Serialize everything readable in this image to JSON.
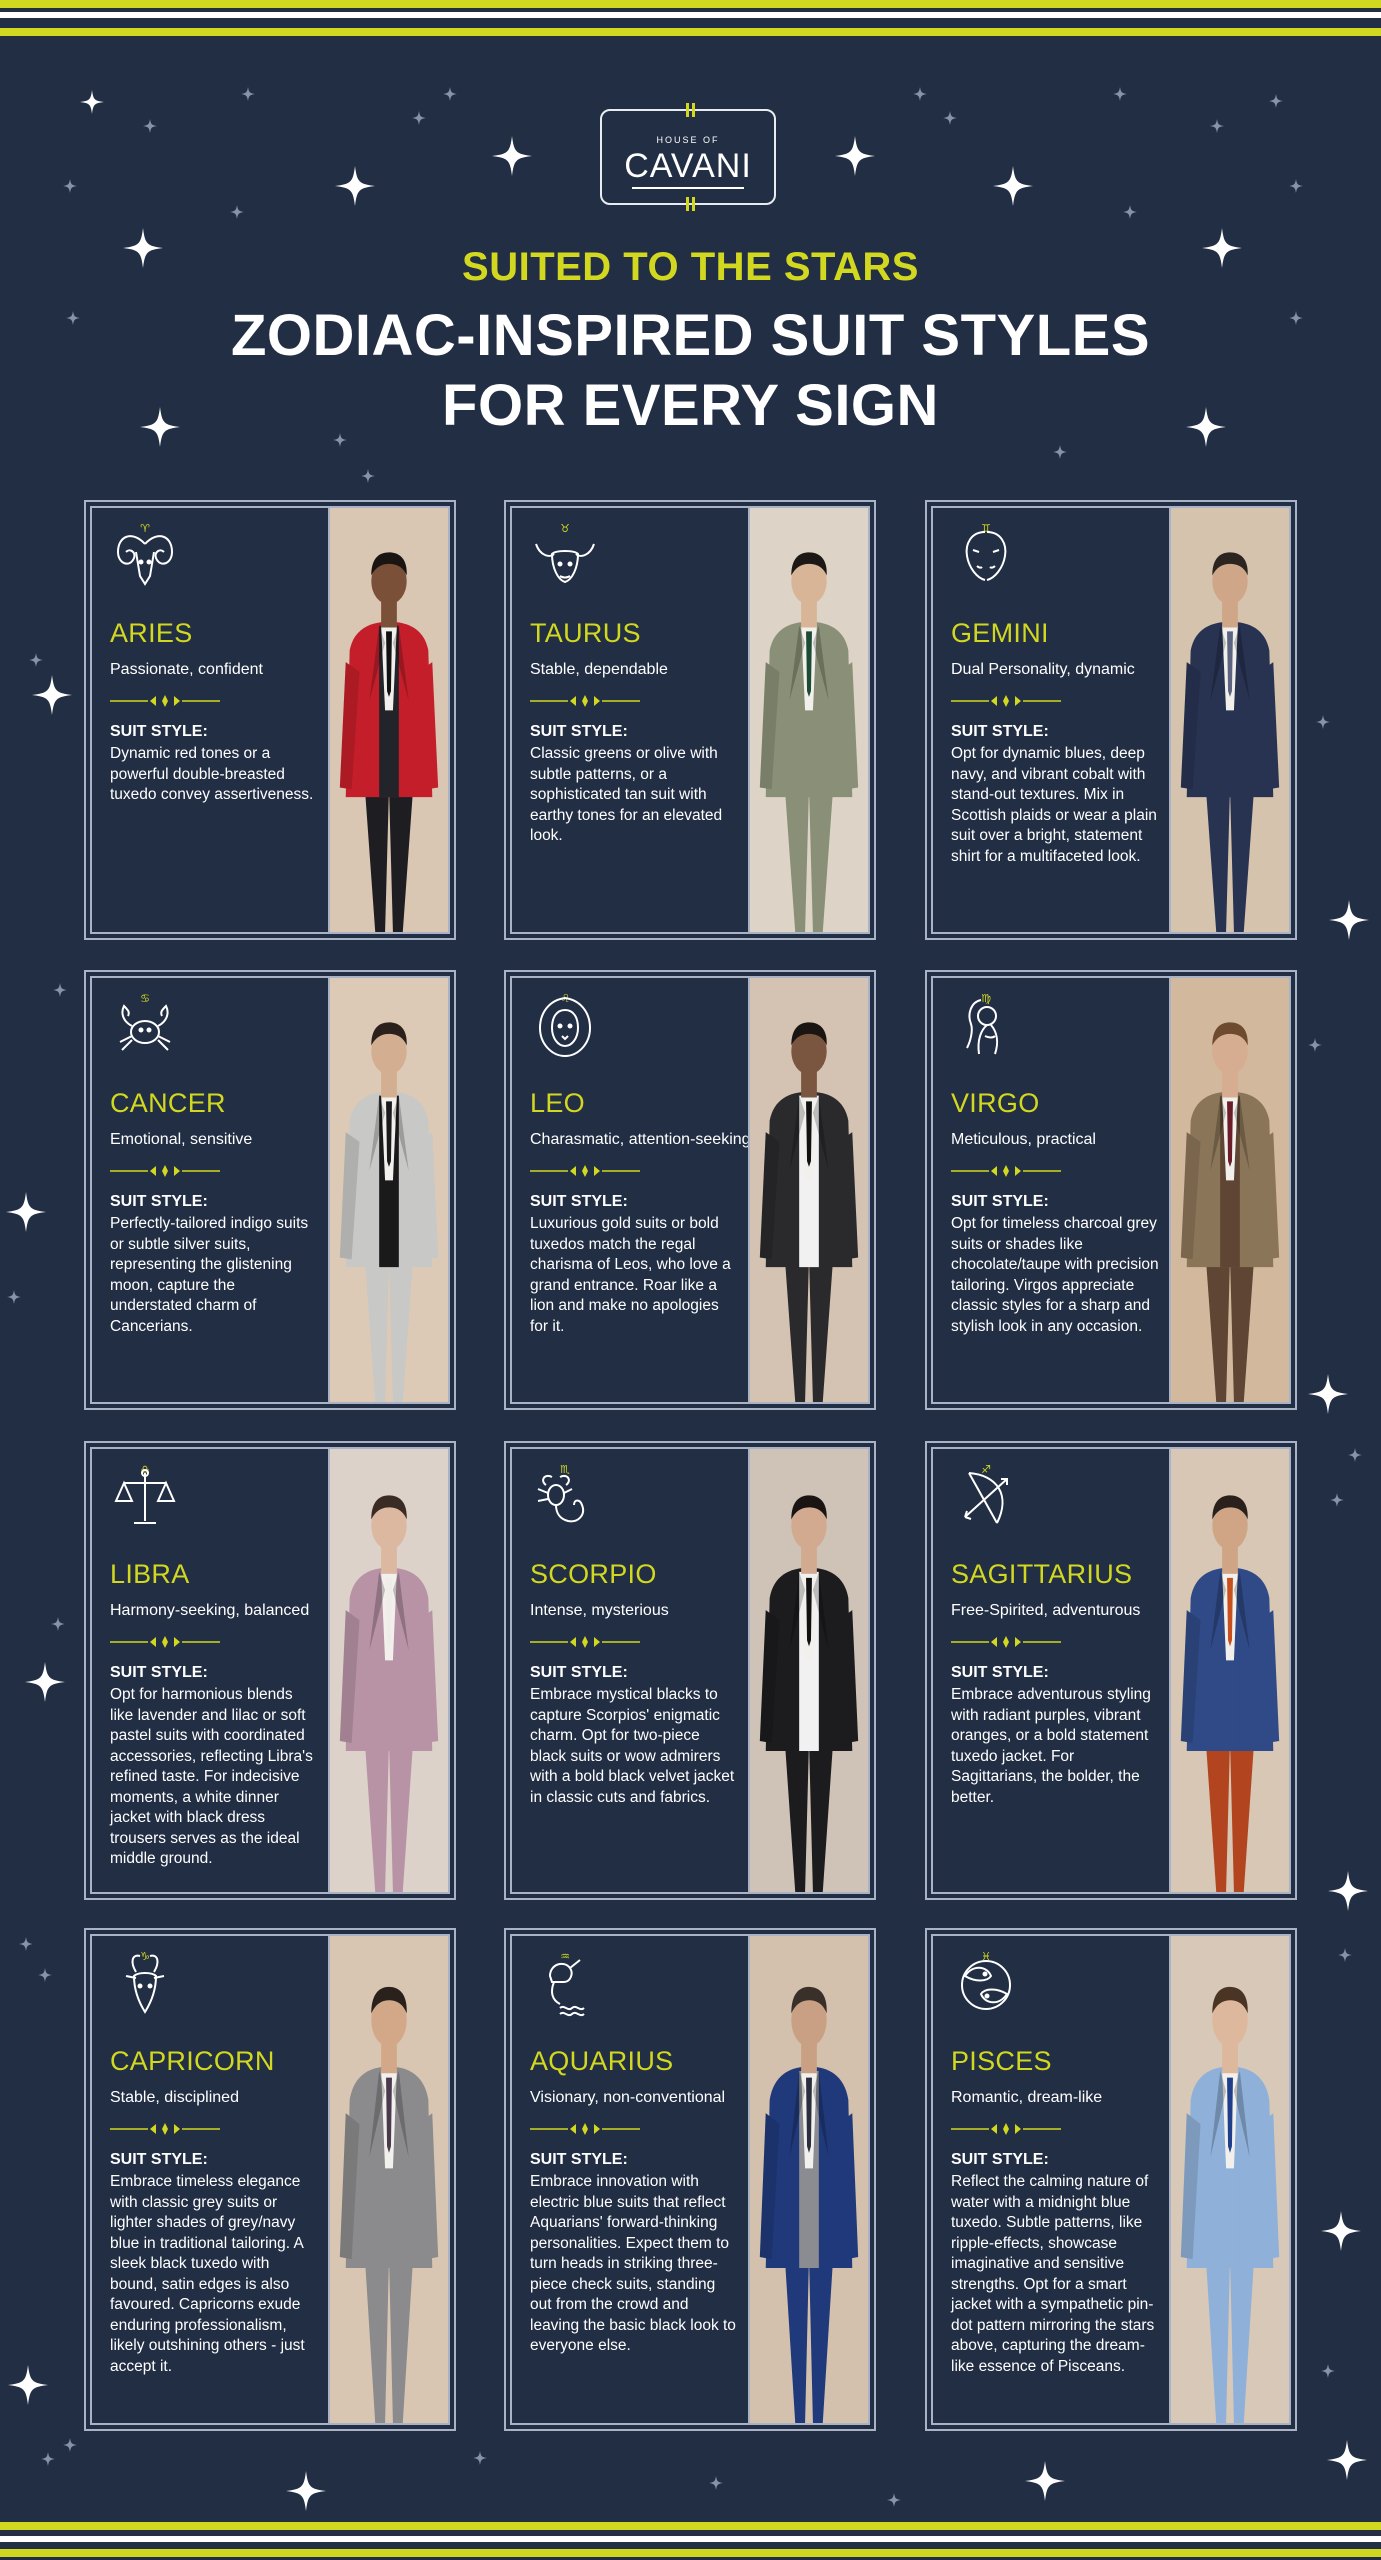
{
  "brand": {
    "house_of": "HOUSE OF",
    "name": "CAVANI"
  },
  "header": {
    "kicker": "SUITED TO THE STARS",
    "title_line1": "ZODIAC-INSPIRED SUIT STYLES",
    "title_line2": "FOR EVERY SIGN"
  },
  "colors": {
    "background": "#222e44",
    "accent": "#d2d81f",
    "text": "#ffffff",
    "border": "#aab3c6"
  },
  "suit_style_label": "SUIT STYLE:",
  "signs": [
    {
      "name": "ARIES",
      "trait": "Passionate, confident",
      "description": "Dynamic red tones or a powerful double-breasted tuxedo convey assertiveness.",
      "icon": "ram-icon",
      "glyph": "♈",
      "suit_color": "#c41e2a",
      "inner_color": "#23232a",
      "skin": "#7a5038",
      "hair": "#1a1512",
      "backdrop": "#d9c6b3",
      "trouser_color": "#1e1e22",
      "tie_color": "#111111"
    },
    {
      "name": "TAURUS",
      "trait": "Stable, dependable",
      "description": "Classic greens or olive with subtle patterns, or a sophisticated tan suit with earthy tones for an elevated look.",
      "icon": "bull-icon",
      "glyph": "♉",
      "suit_color": "#8a9077",
      "inner_color": "#8a9077",
      "skin": "#d8b596",
      "hair": "#1c1815",
      "backdrop": "#ddd3c6",
      "trouser_color": "#8a9077",
      "tie_color": "#1d4a34"
    },
    {
      "name": "GEMINI",
      "trait": "Dual Personality, dynamic",
      "description": "Opt for dynamic blues, deep navy, and vibrant cobalt with stand-out textures. Mix in Scottish plaids or wear a plain suit over a bright, statement shirt for a multifaceted look.",
      "icon": "twins-icon",
      "glyph": "♊",
      "suit_color": "#283352",
      "inner_color": "#283352",
      "skin": "#cfa688",
      "hair": "#2b2420",
      "backdrop": "#d6c3ae",
      "trouser_color": "#283352",
      "tie_color": "#5c6480"
    },
    {
      "name": "CANCER",
      "trait": "Emotional, sensitive",
      "description": "Perfectly-tailored indigo suits or subtle silver suits, representing the glistening moon, capture the understated charm of Cancerians.",
      "icon": "crab-icon",
      "glyph": "♋",
      "suit_color": "#c8c8c6",
      "inner_color": "#1a1a1a",
      "skin": "#d4ae90",
      "hair": "#2a211c",
      "backdrop": "#dccab6",
      "trouser_color": "#c8c8c6",
      "tie_color": "#1a1a1a"
    },
    {
      "name": "LEO",
      "trait": "Charasmatic, attention-seeking",
      "description": "Luxurious gold suits or bold tuxedos match the regal charisma of Leos, who love a grand entrance. Roar like a lion and make no apologies for it.",
      "icon": "lion-icon",
      "glyph": "♌",
      "suit_color": "#2a2a2c",
      "inner_color": "#f1f1f1",
      "skin": "#7a5540",
      "hair": "#1a1512",
      "backdrop": "#d4c3b3",
      "trouser_color": "#2a2a2c",
      "tie_color": "#111111"
    },
    {
      "name": "VIRGO",
      "trait": "Meticulous, practical",
      "description": "Opt for timeless charcoal grey suits or shades like chocolate/taupe with precision tailoring. Virgos appreciate classic styles for a sharp and stylish look in any occasion.",
      "icon": "maiden-icon",
      "glyph": "♍",
      "suit_color": "#8a7558",
      "inner_color": "#5e4534",
      "skin": "#d6ad90",
      "hair": "#6e4a2e",
      "backdrop": "#d2b99d",
      "trouser_color": "#5e4534",
      "tie_color": "#6b1e2a"
    },
    {
      "name": "LIBRA",
      "trait": "Harmony-seeking, balanced",
      "description": "Opt for harmonious blends like lavender and lilac or soft pastel suits with coordinated accessories, reflecting Libra's refined taste. For indecisive moments, a white dinner jacket with black dress trousers serves as the ideal middle ground.",
      "icon": "scales-icon",
      "glyph": "♎",
      "suit_color": "#b893a6",
      "inner_color": "#b893a6",
      "skin": "#dcb8a0",
      "hair": "#3a2c24",
      "backdrop": "#ddd2ca",
      "trouser_color": "#b893a6",
      "tie_color": "#f0ece8"
    },
    {
      "name": "SCORPIO",
      "trait": "Intense, mysterious",
      "description": "Embrace mystical blacks to capture Scorpios' enigmatic charm. Opt for two-piece black suits or wow admirers with a bold black velvet jacket in classic cuts and fabrics.",
      "icon": "scorpion-icon",
      "glyph": "♏",
      "suit_color": "#1c1c1e",
      "inner_color": "#f1f1f1",
      "skin": "#d2aa90",
      "hair": "#1a1512",
      "backdrop": "#cfc2b6",
      "trouser_color": "#1c1c1e",
      "tie_color": "#111111"
    },
    {
      "name": "SAGITTARIUS",
      "trait": "Free-Spirited, adventurous",
      "description": "Embrace adventurous styling with radiant purples, vibrant oranges, or a bold statement tuxedo jacket. For Sagittarians, the bolder, the better.",
      "icon": "bow-and-arrow-icon",
      "glyph": "♐",
      "suit_color": "#2f4a86",
      "inner_color": "#2f4a86",
      "skin": "#cfa586",
      "hair": "#2a211c",
      "backdrop": "#d8c7b4",
      "trouser_color": "#b2451f",
      "tie_color": "#c8501e"
    },
    {
      "name": "CAPRICORN",
      "trait": "Stable, disciplined",
      "description": "Embrace timeless elegance with classic grey suits or lighter shades of grey/navy blue in traditional tailoring. A sleek black tuxedo with bound, satin edges is also favoured. Capricorns exude enduring professionalism, likely outshining others - just accept it.",
      "icon": "goat-icon",
      "glyph": "♑",
      "suit_color": "#8b8b8d",
      "inner_color": "#8b8b8d",
      "skin": "#d2a888",
      "hair": "#2a211c",
      "backdrop": "#d9c6b2",
      "trouser_color": "#8b8b8d",
      "tie_color": "#4a3a4e"
    },
    {
      "name": "AQUARIUS",
      "trait": "Visionary, non-conventional",
      "description": "Embrace innovation with electric blue suits that reflect Aquarians' forward-thinking personalities. Expect them to turn heads in striking three-piece check suits, standing out from the crowd and leaving the basic black look to everyone else.",
      "icon": "water-bearer-icon",
      "glyph": "♒",
      "suit_color": "#20397a",
      "inner_color": "#8a8c92",
      "skin": "#c9a084",
      "hair": "#3a302a",
      "backdrop": "#d4c1ad",
      "trouser_color": "#20397a",
      "tie_color": "#2a2e3e"
    },
    {
      "name": "PISCES",
      "trait": "Romantic, dream-like",
      "description": "Reflect the calming nature of water with a midnight blue tuxedo. Subtle patterns, like ripple-effects, showcase imaginative and sensitive strengths. Opt for a smart jacket with a sympathetic pin-dot pattern mirroring the stars above, capturing the dream-like essence of Pisceans.",
      "icon": "fish-icon",
      "glyph": "♓",
      "suit_color": "#8fb0d8",
      "inner_color": "#8fb0d8",
      "skin": "#ddb89c",
      "hair": "#4a3424",
      "backdrop": "#d8c8b8",
      "trouser_color": "#8fb0d8",
      "tie_color": "#1f3f8a"
    }
  ]
}
